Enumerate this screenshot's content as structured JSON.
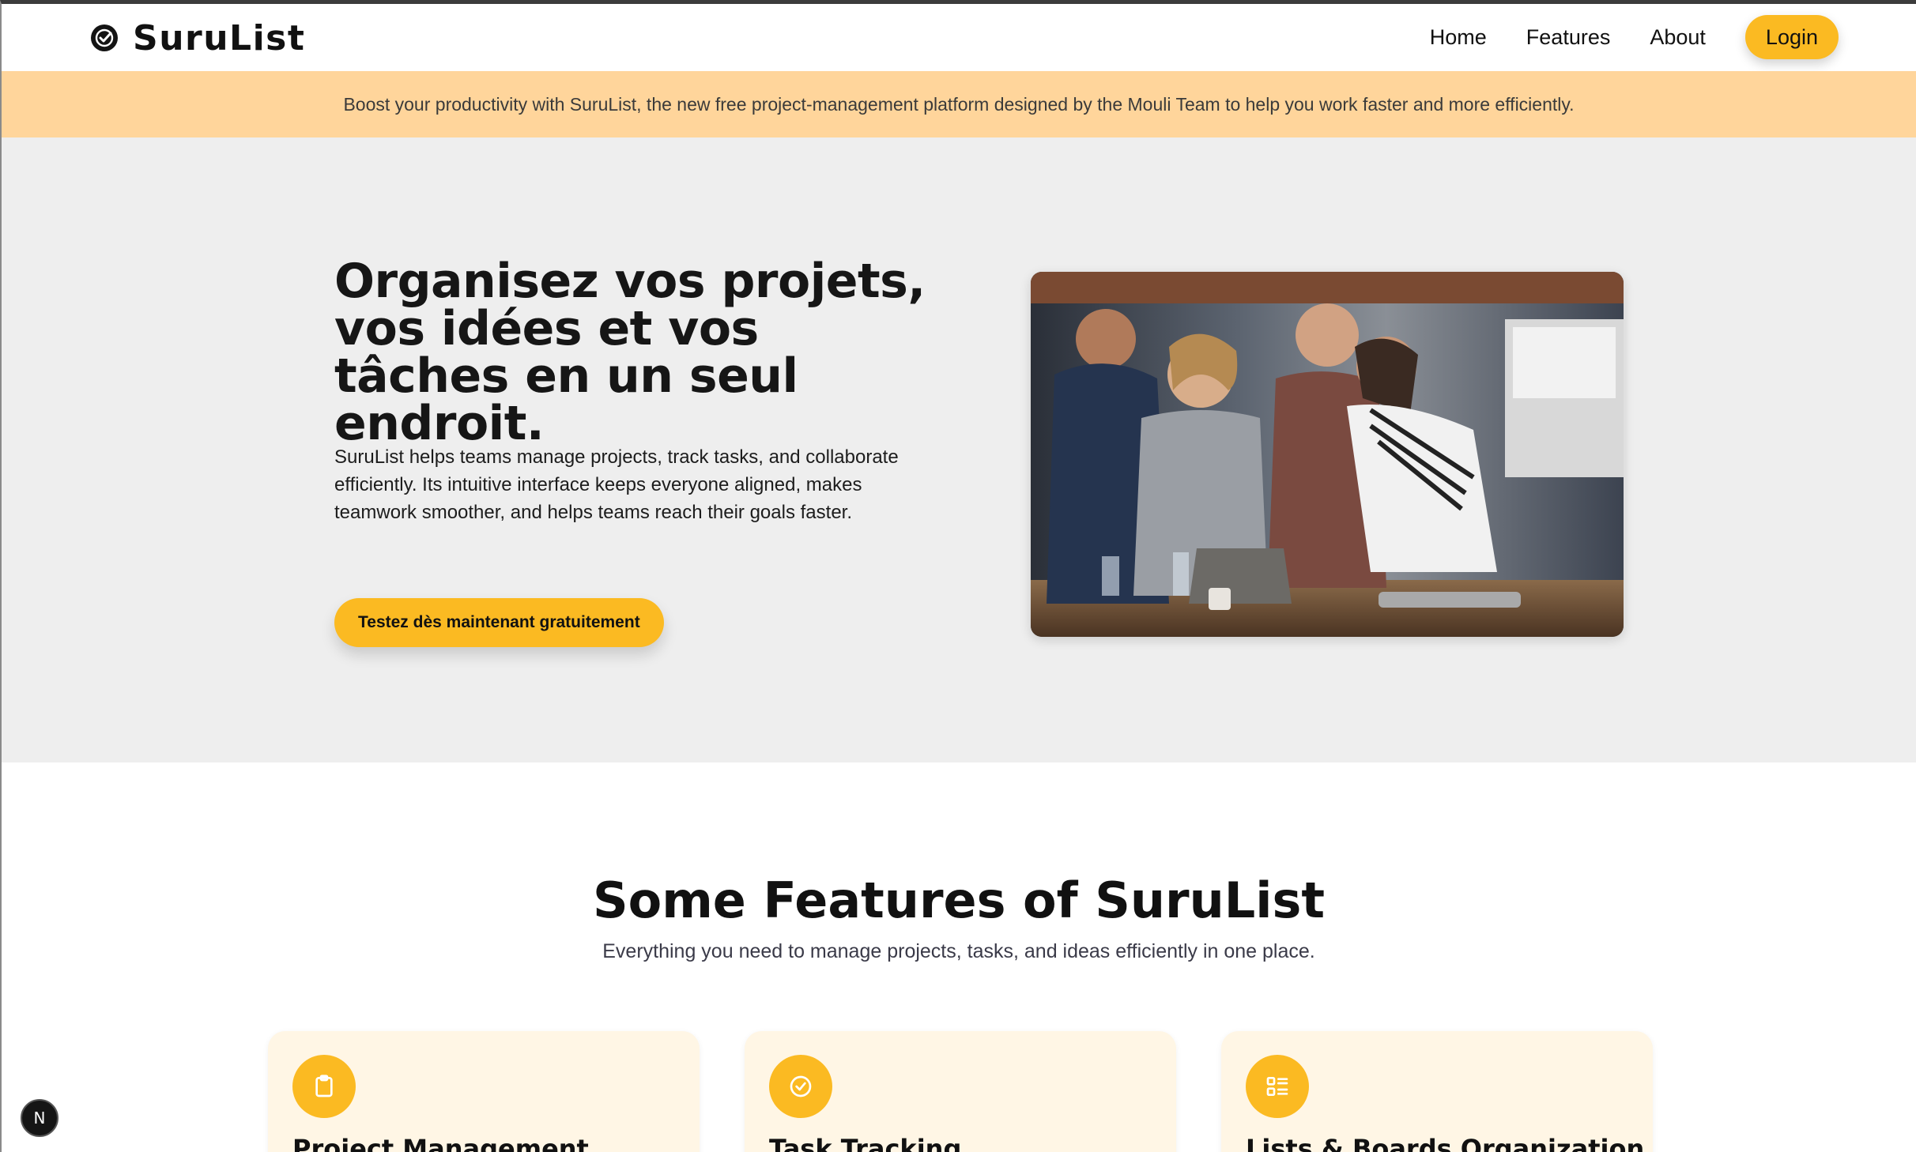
{
  "navbar": {
    "brand": "SuruList",
    "links": [
      {
        "label": "Home"
      },
      {
        "label": "Features"
      },
      {
        "label": "About"
      }
    ],
    "login_label": "Login"
  },
  "banner": {
    "text": "Boost your productivity with SuruList, the new free project-management platform designed by the Mouli Team to help you work faster and more efficiently."
  },
  "hero": {
    "title": "Organisez vos projets, vos idées et vos tâches en un seul endroit.",
    "description": "SuruList helps teams manage projects, track tasks, and collaborate efficiently. Its intuitive interface keeps everyone aligned, makes teamwork smoother, and helps teams reach their goals faster.",
    "cta_label": "Testez dès maintenant gratuitement"
  },
  "features": {
    "title": "Some Features of SuruList",
    "subtitle": "Everything you need to manage projects, tasks, and ideas efficiently in one place.",
    "cards": [
      {
        "title": "Project Management",
        "icon": "clipboard-icon"
      },
      {
        "title": "Task Tracking",
        "icon": "check-circle-icon"
      },
      {
        "title": "Lists & Boards Organization",
        "icon": "list-grid-icon"
      }
    ]
  },
  "dev_badge": {
    "label": "N"
  },
  "colors": {
    "accent": "#fbba22",
    "banner_bg": "#ffd59b",
    "hero_bg": "#eeeeee",
    "card_bg": "#fff6e5"
  }
}
